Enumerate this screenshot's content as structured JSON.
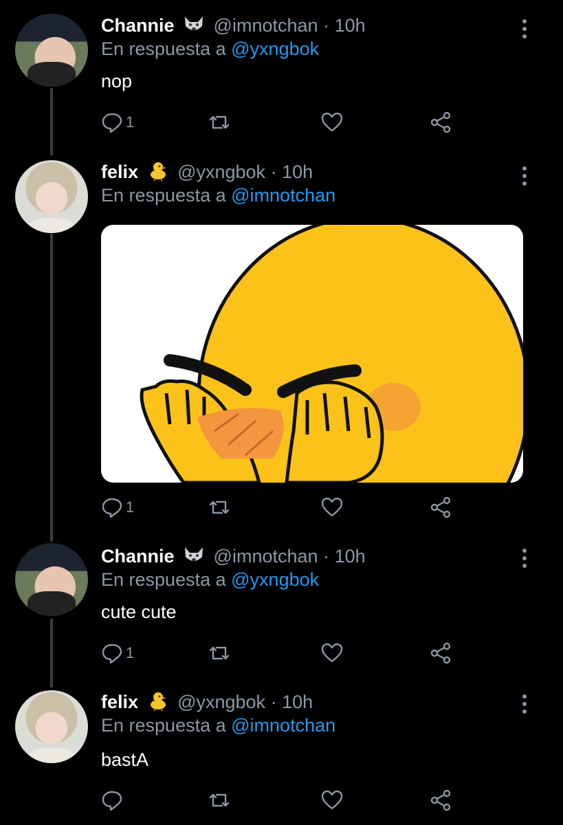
{
  "tweets": [
    {
      "name": "Channie",
      "emoji": "wolf-emoji",
      "handle": "@imnotchan",
      "time": "10h",
      "reply_prefix": "En respuesta a",
      "reply_to": "@yxngbok",
      "text": "nop",
      "reply_count": "1"
    },
    {
      "name": "felix",
      "emoji": "chick-emoji",
      "handle": "@yxngbok",
      "time": "10h",
      "reply_prefix": "En respuesta a",
      "reply_to": "@imnotchan",
      "text": "",
      "media": "blushing-emoji-meme-image",
      "reply_count": "1"
    },
    {
      "name": "Channie",
      "emoji": "wolf-emoji",
      "handle": "@imnotchan",
      "time": "10h",
      "reply_prefix": "En respuesta a",
      "reply_to": "@yxngbok",
      "text": "cute cute",
      "reply_count": "1"
    },
    {
      "name": "felix",
      "emoji": "chick-emoji",
      "handle": "@yxngbok",
      "time": "10h",
      "reply_prefix": "En respuesta a",
      "reply_to": "@imnotchan",
      "text": "bastA",
      "reply_count": ""
    }
  ],
  "separator": "·",
  "colors": {
    "background": "#000000",
    "muted": "#8b98a5",
    "link": "#1d9bf0",
    "thread_line": "#3a3f44"
  }
}
